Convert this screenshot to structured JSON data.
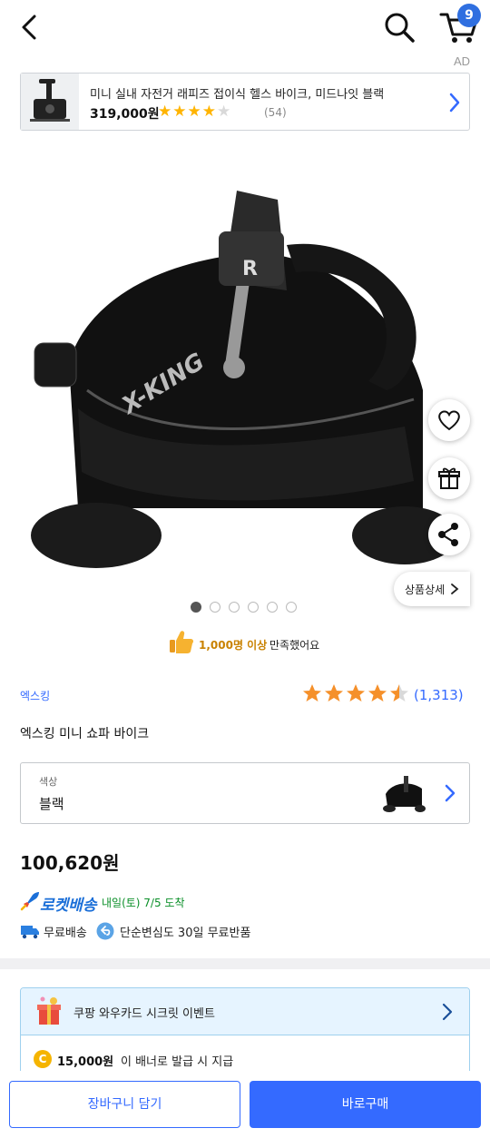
{
  "header": {
    "cart_count": "9"
  },
  "ad": {
    "label": "AD",
    "title": "미니 실내 자전거 래피즈 접이식 헬스 바이크, 미드나잇 블랙",
    "price": "319,000원",
    "rating_stars": 4,
    "review_count": "(54)"
  },
  "gallery": {
    "image_count": 6,
    "active_index": 0,
    "detail_label": "상품상세"
  },
  "satisfaction": {
    "count_text": "1,000명 이상",
    "rest_text": "만족했어요"
  },
  "product": {
    "brand": "엑스킹",
    "rating_stars": 4.5,
    "review_count": "(1,313)",
    "title": "엑스킹 미니 쇼파 바이크",
    "option_label": "색상",
    "option_value": "블랙",
    "price": "100,620원"
  },
  "delivery": {
    "rocket_label": "로켓배송",
    "arrival": "내일(토) 7/5 도착",
    "perks": [
      "무료배송",
      "단순변심도 30일 무료반품"
    ]
  },
  "event": {
    "title": "쿠팡 와우카드 시크릿 이벤트",
    "coin_symbol": "C",
    "amount": "15,000원",
    "note": "이 배너로 발급 시 지급"
  },
  "actions": {
    "add_to_cart": "장바구니 담기",
    "buy_now": "바로구매"
  },
  "colors": {
    "accent": "#346aff",
    "badge": "#2f6fe0",
    "star": "#f5902a",
    "rocket": "#1b6fd8",
    "arrival": "#0a8f28"
  }
}
